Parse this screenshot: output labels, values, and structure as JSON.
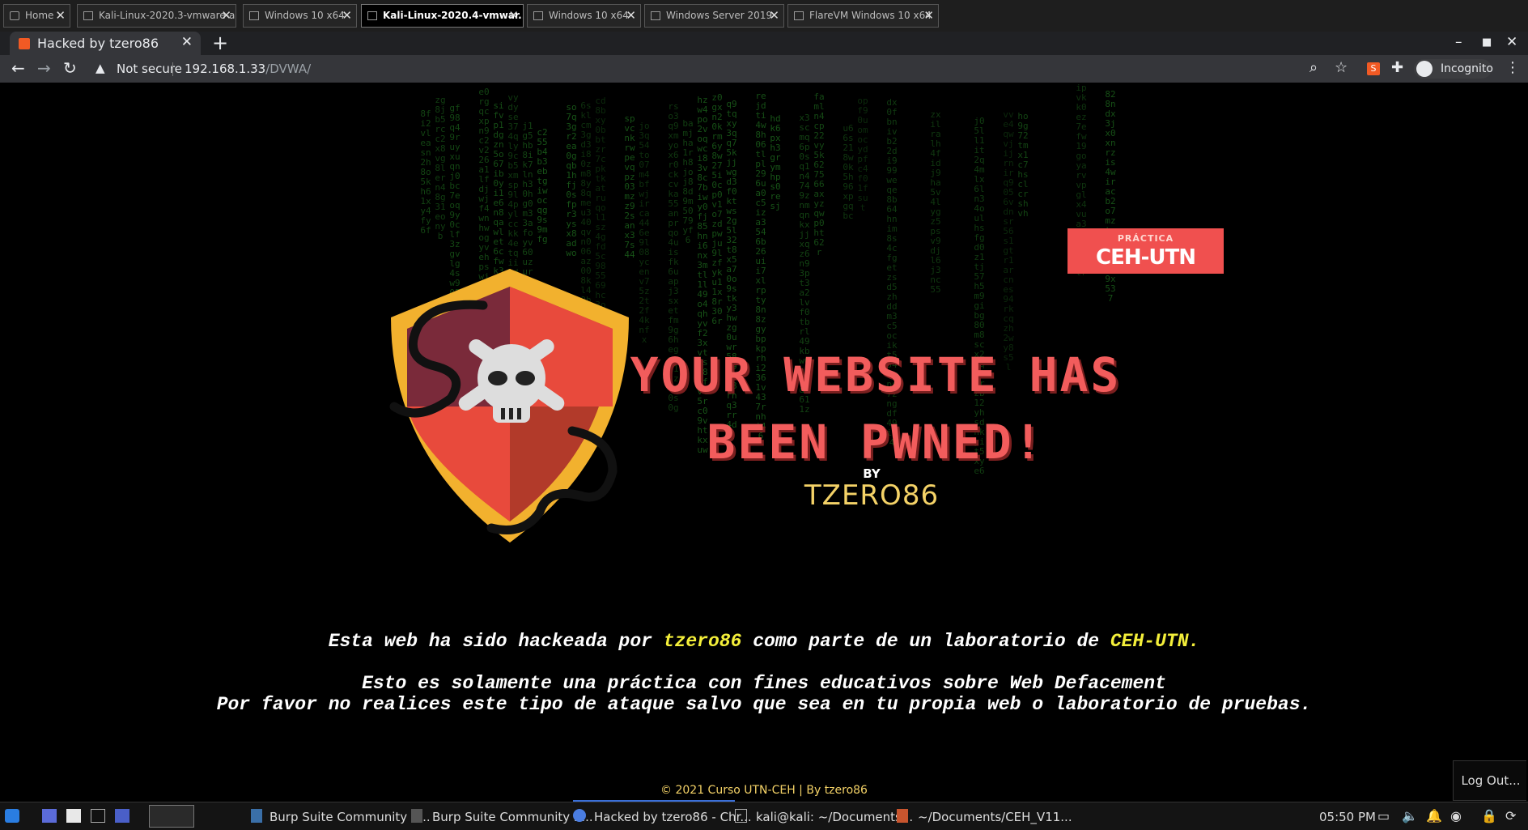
{
  "vm_tabs": [
    {
      "label": "Home",
      "active": false
    },
    {
      "label": "Kali-Linux-2020.3-vmware-am...",
      "active": false
    },
    {
      "label": "Windows 10 x64",
      "active": false
    },
    {
      "label": "Kali-Linux-2020.4-vmwar...",
      "active": true
    },
    {
      "label": "Windows 10 x64",
      "active": false
    },
    {
      "label": "Windows Server 2019",
      "active": false
    },
    {
      "label": "FlareVM Windows 10 x64",
      "active": false
    }
  ],
  "browser": {
    "tab_title": "Hacked by tzero86",
    "security_label": "Not secure",
    "url_host": "192.168.1.33",
    "url_path": "/DVWA/",
    "profile_label": "Incognito"
  },
  "page": {
    "badge_small": "PRÁCTICA",
    "badge_big": "CEH-UTN",
    "headline_line1": "YOUR WEBSITE HAS",
    "headline_line2": "BEEN PWNED!",
    "by": "BY",
    "author": "TZERO86",
    "msg1_a": "Esta web ha sido hackeada por ",
    "msg1_b": "tzero86",
    "msg1_c": " como parte de un laboratorio de ",
    "msg1_d": "CEH-UTN.",
    "msg2": "Esto es solamente una práctica con fines educativos sobre Web Defacement",
    "msg3": "Por favor no realices este tipo de ataque salvo que sea en tu propia web o laboratorio de pruebas.",
    "footer": "© 2021 Curso UTN-CEH | By tzero86",
    "logout": "Log Out..."
  },
  "taskbar": {
    "items": [
      "Burp Suite Community E...",
      "Burp Suite Community E...",
      "Hacked by tzero86 - Chr...",
      "kali@kali: ~/Documents...",
      "~/Documents/CEH_V11..."
    ],
    "clock": "05:50 PM"
  },
  "colors": {
    "accent_red": "#f25c5c",
    "badge_bg": "#f0504f",
    "gold": "#f4d267",
    "highlight_yellow": "#f4ef3a",
    "matrix_green": "#1e6b1e"
  },
  "icons": [
    "back-icon",
    "forward-icon",
    "reload-icon",
    "warning-icon",
    "zoom-icon",
    "star-icon",
    "extension-icon",
    "incognito-icon",
    "menu-icon",
    "shield-skull-icon"
  ]
}
